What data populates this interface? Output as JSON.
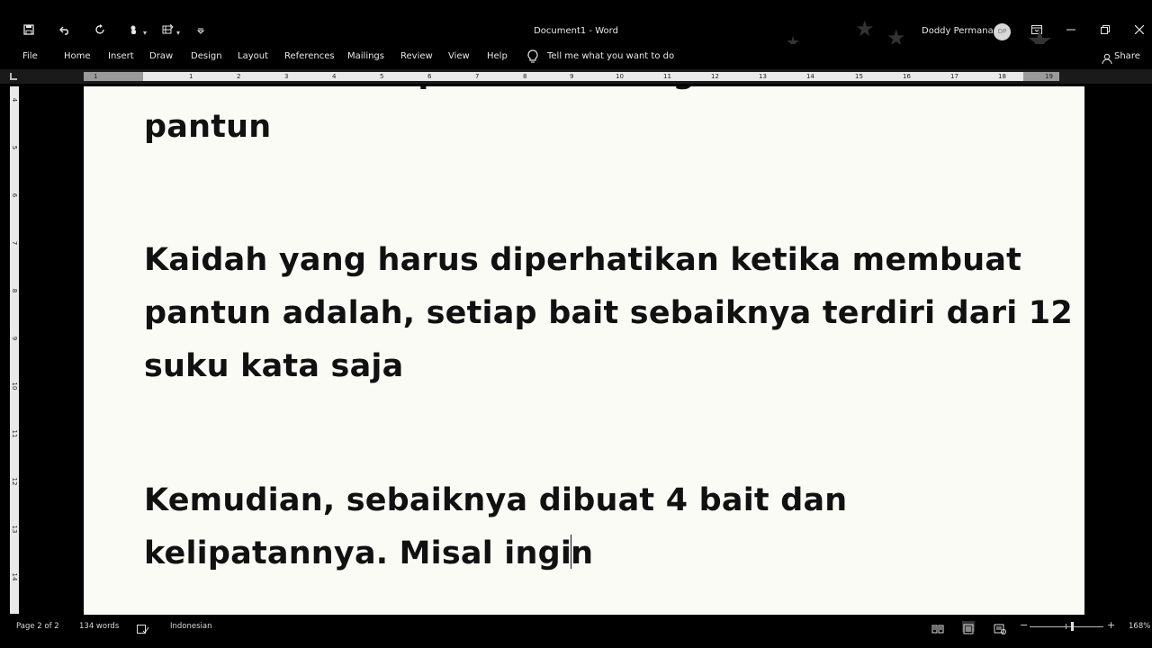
{
  "titlebar": {
    "document_title": "Document1  -  Word",
    "user_name": "Doddy Permana",
    "user_initials": "DP"
  },
  "ribbon": {
    "tabs": [
      "File",
      "Home",
      "Insert",
      "Draw",
      "Design",
      "Layout",
      "References",
      "Mailings",
      "Review",
      "View",
      "Help"
    ],
    "tell_me": "Tell me what you want to do",
    "share": "Share"
  },
  "ruler": {
    "horizontal_numbers": [
      "1",
      "1",
      "2",
      "3",
      "4",
      "5",
      "6",
      "7",
      "8",
      "9",
      "10",
      "11",
      "12",
      "13",
      "14",
      "15",
      "16",
      "17",
      "18",
      "19"
    ],
    "vertical_numbers": [
      "4",
      "5",
      "6",
      "7",
      "8",
      "9",
      "10",
      "11",
      "12",
      "13",
      "14"
    ]
  },
  "document": {
    "clipped_line": "Berikut contoh pantun tentang kata-kata",
    "lines": [
      "pantun",
      "Kaidah yang harus diperhatikan ketika membuat",
      "pantun adalah, setiap bait sebaiknya terdiri dari 12",
      "suku kata saja",
      "Kemudian, sebaiknya dibuat 4 bait dan",
      "kelipatannya. Misal ingi",
      "n"
    ]
  },
  "statusbar": {
    "page": "Page 2 of 2",
    "words": "134 words",
    "language": "Indonesian",
    "zoom_minus": "−",
    "zoom_plus": "+",
    "zoom_level": "168%"
  }
}
